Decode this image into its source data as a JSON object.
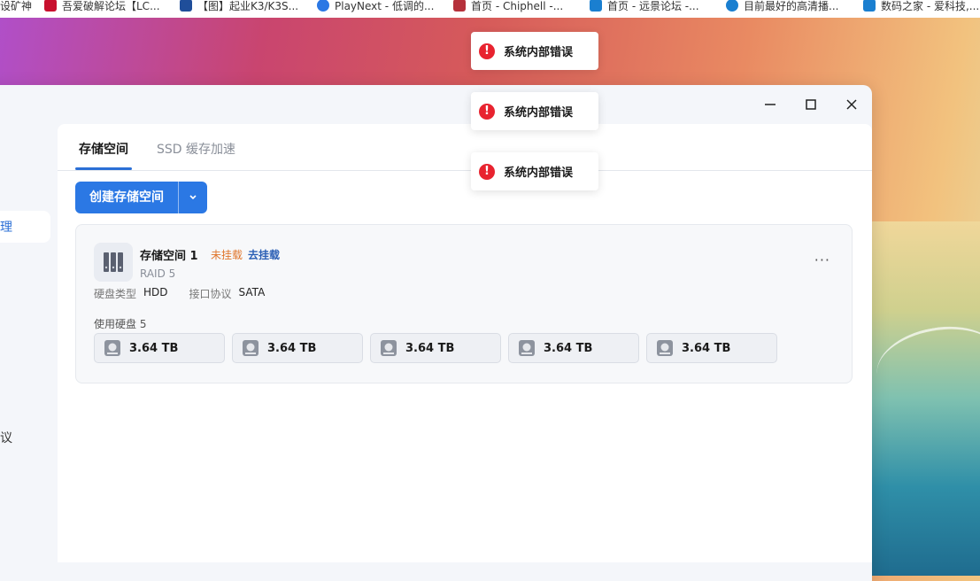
{
  "bookmarks": [
    {
      "label": "设矿神",
      "color": "#333333"
    },
    {
      "label": "吾爱破解论坛【LC...",
      "color": "#c8102e"
    },
    {
      "label": "【图】起业K3/K3S...",
      "color": "#1f4e9a"
    },
    {
      "label": "PlayNext - 低调的...",
      "color": "#2b78e4"
    },
    {
      "label": "首页 - Chiphell -...",
      "color": "#b5313b"
    },
    {
      "label": "首页 - 远景论坛 -...",
      "color": "#1a7fd0"
    },
    {
      "label": "目前最好的高清播...",
      "color": "#1a7fd0"
    },
    {
      "label": "数码之家 - 爱科技,...",
      "color": "#1a7fd0"
    }
  ],
  "window": {
    "controls": {
      "minimize": "—",
      "maximize": "☐",
      "close": "✕"
    }
  },
  "sidebar": {
    "active_item": "理",
    "item_2": "议"
  },
  "tabs": [
    {
      "label": "存储空间",
      "active": true
    },
    {
      "label": "SSD 缓存加速",
      "active": false
    }
  ],
  "create_button": {
    "label": "创建存储空间",
    "dropdown": "⌄"
  },
  "pool": {
    "name": "存储空间 1",
    "status": "未挂载",
    "mount_action": "去挂载",
    "raid": "RAID 5",
    "disk_type_label": "硬盘类型",
    "disk_type": "HDD",
    "protocol_label": "接口协议",
    "protocol": "SATA",
    "disks_used_label": "使用硬盘 5",
    "more": "···",
    "disks": [
      "3.64 TB",
      "3.64 TB",
      "3.64 TB",
      "3.64 TB",
      "3.64 TB"
    ]
  },
  "toasts": [
    {
      "icon": "!",
      "message": "系统内部错误"
    },
    {
      "icon": "!",
      "message": "系统内部错误"
    },
    {
      "icon": "!",
      "message": "系统内部错误"
    }
  ],
  "colors": {
    "accent": "#2b78e4",
    "error": "#e8232f",
    "warning": "#e0762c"
  }
}
